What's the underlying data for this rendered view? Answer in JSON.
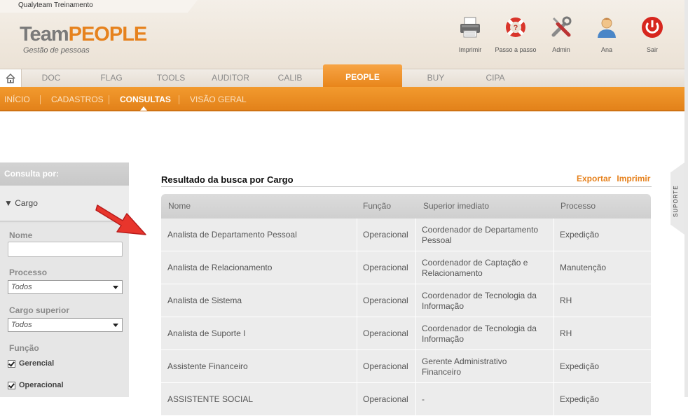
{
  "app": {
    "company": "Qualyteam Treinamento",
    "logo_team": "Team",
    "logo_people": "PEOPLE",
    "logo_sub": "Gestão de pessoas"
  },
  "toolbar": [
    {
      "label": "Imprimir",
      "icon": "printer-icon"
    },
    {
      "label": "Passo a passo",
      "icon": "lifebuoy-icon"
    },
    {
      "label": "Admin",
      "icon": "tools-icon"
    },
    {
      "label": "Ana",
      "icon": "user-icon"
    },
    {
      "label": "Sair",
      "icon": "power-icon"
    }
  ],
  "module_tabs": [
    "DOC",
    "FLAG",
    "TOOLS",
    "AUDITOR",
    "CALIB",
    "PEOPLE",
    "BUY",
    "CIPA"
  ],
  "active_module": "PEOPLE",
  "subnav": [
    "INÍCIO",
    "CADASTROS",
    "CONSULTAS",
    "VISÃO GERAL"
  ],
  "active_subnav": "CONSULTAS",
  "sidebar": {
    "header": "Consulta por:",
    "section": "▼ Cargo",
    "nome_label": "Nome",
    "nome_value": "",
    "processo_label": "Processo",
    "processo_value": "Todos",
    "cargo_superior_label": "Cargo superior",
    "cargo_superior_value": "Todos",
    "funcao_label": "Função",
    "funcoes": [
      {
        "label": "Gerencial",
        "checked": true
      },
      {
        "label": "Operacional",
        "checked": true
      }
    ]
  },
  "results": {
    "title": "Resultado da busca por Cargo",
    "export_label": "Exportar",
    "print_label": "Imprimir",
    "columns": [
      "Nome",
      "Função",
      "Superior imediato",
      "Processo"
    ],
    "rows": [
      [
        "Analista de Departamento Pessoal",
        "Operacional",
        "Coordenador de Departamento Pessoal",
        "Expedição"
      ],
      [
        "Analista de Relacionamento",
        "Operacional",
        "Coordenador de Captação e Relacionamento",
        "Manutenção"
      ],
      [
        "Analista de Sistema",
        "Operacional",
        "Coordenador de Tecnologia da Informação",
        "RH"
      ],
      [
        "Analista de Suporte I",
        "Operacional",
        "Coordenador de Tecnologia da Informação",
        "RH"
      ],
      [
        "Assistente Financeiro",
        "Operacional",
        "Gerente Administrativo Financeiro",
        "Expedição"
      ],
      [
        "ASSISTENTE SOCIAL",
        "Operacional",
        "-",
        "Expedição"
      ]
    ]
  },
  "support_tab": "SUPORTE",
  "colors": {
    "accent": "#e6821e",
    "header_bg": "#efe7dc",
    "table_row": "#ececec"
  }
}
